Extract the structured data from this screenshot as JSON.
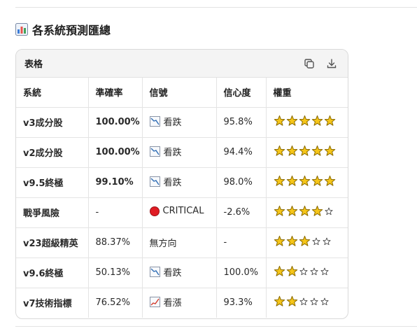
{
  "heading": {
    "icon": "bar-chart-icon",
    "title": "各系統預測匯總"
  },
  "table": {
    "title": "表格",
    "tools": [
      "copy-icon",
      "download-icon"
    ],
    "columns": [
      "系統",
      "準確率",
      "信號",
      "信心度",
      "權重"
    ],
    "rows": [
      {
        "system": "v3成分股",
        "accuracy": "100.00%",
        "accuracy_bold": true,
        "signal_icon": "chart-down-icon",
        "signal": "看跌",
        "confidence": "95.8%",
        "stars_full": 5,
        "stars_empty": 0
      },
      {
        "system": "v2成分股",
        "accuracy": "100.00%",
        "accuracy_bold": true,
        "signal_icon": "chart-down-icon",
        "signal": "看跌",
        "confidence": "94.4%",
        "stars_full": 5,
        "stars_empty": 0
      },
      {
        "system": "v9.5終極",
        "accuracy": "99.10%",
        "accuracy_bold": true,
        "signal_icon": "chart-down-icon",
        "signal": "看跌",
        "confidence": "98.0%",
        "stars_full": 5,
        "stars_empty": 0
      },
      {
        "system": "戰爭風險",
        "accuracy": "-",
        "accuracy_bold": false,
        "signal_icon": "red-circle-icon",
        "signal": "CRITICAL",
        "confidence": "-2.6%",
        "stars_full": 4,
        "stars_empty": 1
      },
      {
        "system": "v23超級精英",
        "accuracy": "88.37%",
        "accuracy_bold": false,
        "signal_icon": "",
        "signal": "無方向",
        "confidence": "-",
        "stars_full": 3,
        "stars_empty": 2
      },
      {
        "system": "v9.6終極",
        "accuracy": "50.13%",
        "accuracy_bold": false,
        "signal_icon": "chart-down-icon",
        "signal": "看跌",
        "confidence": "100.0%",
        "stars_full": 2,
        "stars_empty": 3
      },
      {
        "system": "v7技術指標",
        "accuracy": "76.52%",
        "accuracy_bold": false,
        "signal_icon": "chart-up-icon",
        "signal": "看漲",
        "confidence": "93.3%",
        "stars_full": 2,
        "stars_empty": 3
      }
    ]
  },
  "colors": {
    "star_fill": "#f5c518",
    "star_stroke": "#8a6a00",
    "critical": "#e01c24",
    "chart_down": "#2f6db5",
    "chart_up": "#d33a2c"
  }
}
